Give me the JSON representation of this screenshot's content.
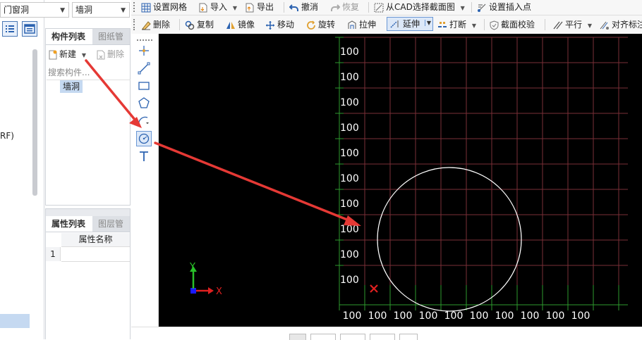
{
  "top_combos": {
    "category": "门窗洞",
    "component": "墙洞"
  },
  "left_strip": {
    "partial_label": "RF)"
  },
  "component_panel": {
    "tabs": [
      "构件列表",
      "图纸管理"
    ],
    "new_label": "新建",
    "delete_label": "删除",
    "search_placeholder": "搜索构件...",
    "items": [
      "墙洞"
    ]
  },
  "property_panel": {
    "tabs": [
      "属性列表",
      "图层管理"
    ],
    "column_header": "属性名称",
    "rows": [
      "1"
    ]
  },
  "toolbar_row1": {
    "set_grid": "设置网格",
    "import": "导入",
    "export": "导出",
    "undo": "撤消",
    "redo": "恢复",
    "select_from_cad": "从CAD选择截面图",
    "set_insert_point": "设置插入点"
  },
  "toolbar_row2": {
    "delete": "删除",
    "copy": "复制",
    "mirror": "镜像",
    "move": "移动",
    "rotate": "旋转",
    "stretch": "拉伸",
    "extend": "延伸",
    "break": "打断",
    "section_check": "截面校验",
    "parallel": "平行",
    "align_dim": "对齐标注"
  },
  "canvas": {
    "row_labels": [
      "100",
      "100",
      "100",
      "100",
      "100",
      "100",
      "100",
      "100",
      "100",
      "100"
    ],
    "col_labels": [
      "100",
      "100",
      "100",
      "100",
      "100",
      "100",
      "100",
      "100",
      "100",
      "100"
    ],
    "axis_x": "X",
    "axis_y": "Y",
    "colors": {
      "background": "#000000",
      "grid": "#7a2f37",
      "tick": "#2e9a2e",
      "label": "#ffffff",
      "circle": "#ffffff",
      "origin": "#e02020",
      "arrow": "#e53935"
    }
  }
}
